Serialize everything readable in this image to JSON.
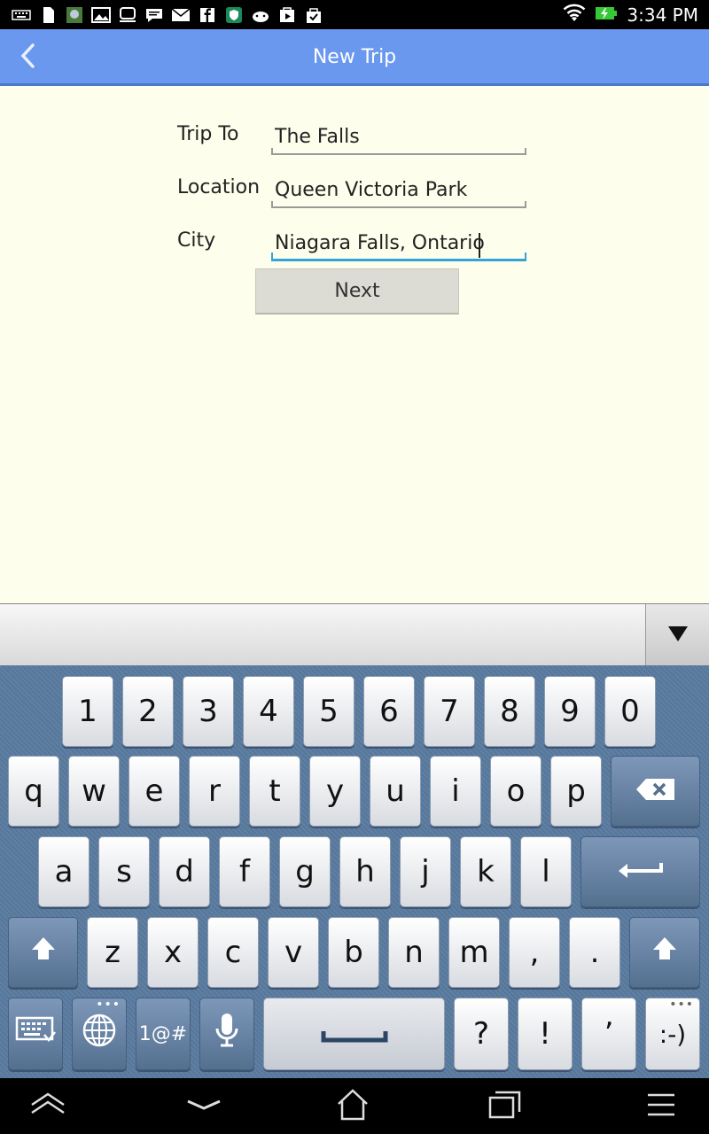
{
  "status_bar": {
    "time": "3:34 PM",
    "notification_icons": [
      "keyboard-icon",
      "sd-card-icon",
      "photo-icon",
      "gallery-icon",
      "gameloft-icon",
      "message-icon",
      "email-icon",
      "facebook-icon",
      "shield-icon",
      "android-icon",
      "play-store-icon",
      "shopping-bag-icon"
    ],
    "wifi_icon": "wifi-icon",
    "battery_icon": "battery-charging-icon"
  },
  "action_bar": {
    "title": "New Trip",
    "back_icon": "chevron-left-icon",
    "color": "#6a98ee"
  },
  "form": {
    "fields": [
      {
        "label": "Trip To",
        "value": "The Falls"
      },
      {
        "label": "Location",
        "value": "Queen Victoria Park"
      },
      {
        "label": "City",
        "value": "Niagara Falls, Ontario"
      }
    ],
    "next_label": "Next",
    "active_color": "#33a3d8",
    "background": "#fefeec"
  },
  "keyboard": {
    "number_row": [
      "1",
      "2",
      "3",
      "4",
      "5",
      "6",
      "7",
      "8",
      "9",
      "0"
    ],
    "row1": [
      "q",
      "w",
      "e",
      "r",
      "t",
      "y",
      "u",
      "i",
      "o",
      "p"
    ],
    "row2": [
      "a",
      "s",
      "d",
      "f",
      "g",
      "h",
      "j",
      "k",
      "l"
    ],
    "row3": [
      "z",
      "x",
      "c",
      "v",
      "b",
      "n",
      "m",
      ",",
      "."
    ],
    "symbols_label": "1@#",
    "question": "?",
    "exclaim": "!",
    "apostrophe": "’",
    "smiley": ":-)",
    "collapse_icon": "triangle-down-icon"
  },
  "nav_bar": {
    "icons": [
      "menu-up-icon",
      "back-chevron-icon",
      "home-icon",
      "recent-apps-icon",
      "menu-icon"
    ]
  }
}
